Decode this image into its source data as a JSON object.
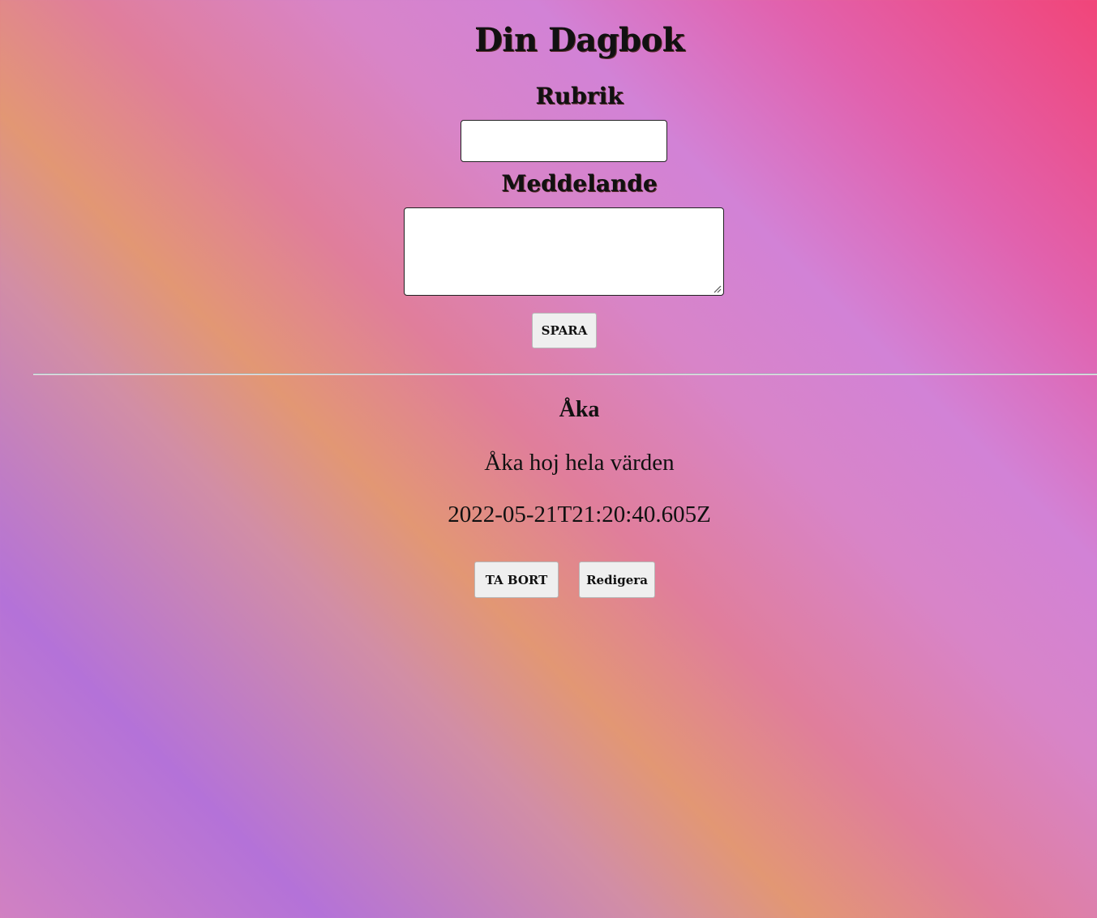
{
  "header": {
    "title": "Din Dagbok"
  },
  "form": {
    "title_label": "Rubrik",
    "title_value": "",
    "message_label": "Meddelande",
    "message_value": "",
    "save_label": "SPARA"
  },
  "entries": [
    {
      "title": "Åka",
      "message": "Åka hoj hela värden",
      "timestamp": "2022-05-21T21:20:40.605Z",
      "delete_label": "TA BORT",
      "edit_label": "Redigera"
    }
  ]
}
